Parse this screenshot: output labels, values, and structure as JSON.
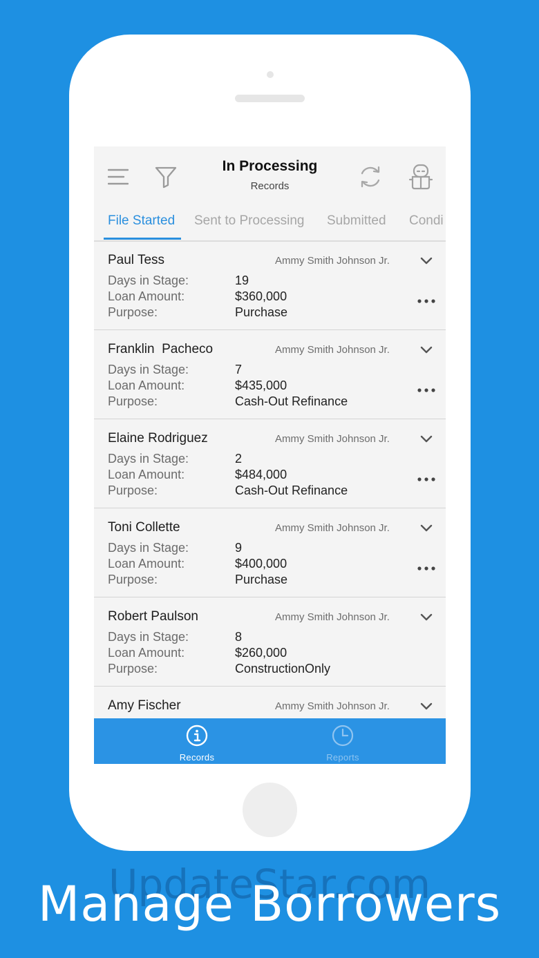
{
  "header": {
    "title": "In Processing",
    "subtitle": "Records",
    "icons": [
      "menu-icon",
      "filter-icon",
      "refresh-icon",
      "robot-icon"
    ]
  },
  "tabs": [
    {
      "label": "File Started",
      "active": true
    },
    {
      "label": "Sent to Processing",
      "active": false
    },
    {
      "label": "Submitted",
      "active": false
    },
    {
      "label": "Condi",
      "active": false
    }
  ],
  "labels": {
    "days": "Days in Stage:",
    "loan": "Loan Amount:",
    "purpose": "Purpose:"
  },
  "records": [
    {
      "name": "Paul Tess",
      "officer": "Ammy Smith Johnson Jr.",
      "days": "19",
      "loan": "$360,000",
      "purpose": "Purchase",
      "has_more": true
    },
    {
      "name": "Franklin  Pacheco",
      "officer": "Ammy Smith Johnson Jr.",
      "days": "7",
      "loan": "$435,000",
      "purpose": "Cash-Out Refinance",
      "has_more": true
    },
    {
      "name": "Elaine Rodriguez",
      "officer": "Ammy Smith Johnson Jr.",
      "days": "2",
      "loan": "$484,000",
      "purpose": "Cash-Out Refinance",
      "has_more": true
    },
    {
      "name": "Toni Collette",
      "officer": "Ammy Smith Johnson Jr.",
      "days": "9",
      "loan": "$400,000",
      "purpose": "Purchase",
      "has_more": true
    },
    {
      "name": "Robert Paulson",
      "officer": "Ammy Smith Johnson Jr.",
      "days": "8",
      "loan": "$260,000",
      "purpose": "ConstructionOnly",
      "has_more": false
    },
    {
      "name": "Amy Fischer",
      "officer": "Ammy Smith Johnson Jr."
    }
  ],
  "tabbar": [
    {
      "label": "Records",
      "icon": "info-icon",
      "active": true
    },
    {
      "label": "Reports",
      "icon": "clock-icon",
      "active": false
    }
  ],
  "caption": "Manage Borrowers",
  "watermark": "UpdateStar.com",
  "colors": {
    "background": "#1e90e2",
    "accent": "#2a8fde",
    "tabbar": "#2b93e4"
  }
}
